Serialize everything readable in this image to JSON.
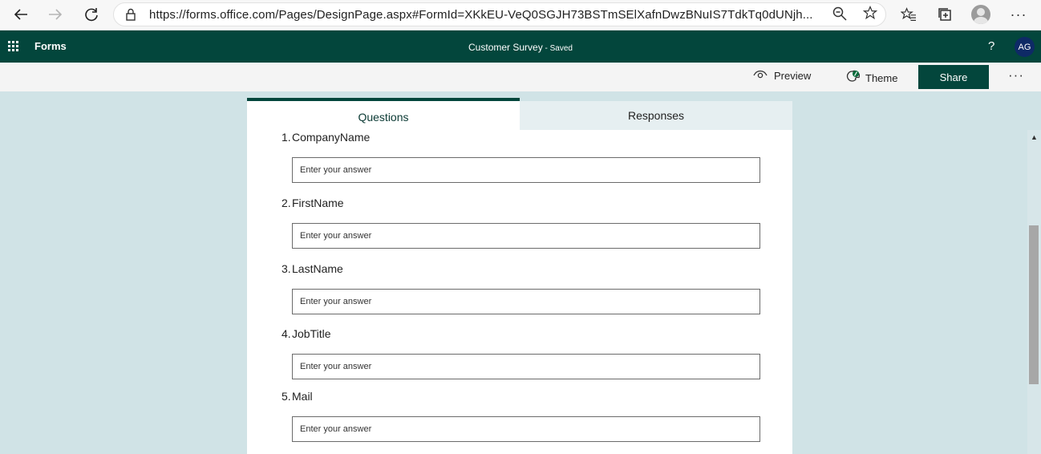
{
  "browser": {
    "url": "https://forms.office.com/Pages/DesignPage.aspx#FormId=XKkEU-VeQ0SGJH73BSTmSElXafnDwzBNuIS7TdkTq0dUNjh...",
    "icons": [
      "back-arrow-icon",
      "forward-arrow-icon",
      "refresh-icon",
      "lock-icon",
      "zoom-icon",
      "favorite-star-icon",
      "favorites-icon",
      "collections-icon",
      "profile-icon",
      "more-icon"
    ]
  },
  "header": {
    "app_name": "Forms",
    "doc_title": "Customer Survey",
    "separator": " - ",
    "status": "Saved",
    "help": "?",
    "avatar_initials": "AG",
    "bg_color": "#03463c"
  },
  "commands": {
    "preview": "Preview",
    "theme": "Theme",
    "share": "Share",
    "more": "···"
  },
  "tabs": {
    "questions": "Questions",
    "responses": "Responses"
  },
  "questions": [
    {
      "number": "1.",
      "title": "CompanyName",
      "placeholder": "Enter your answer"
    },
    {
      "number": "2.",
      "title": "FirstName",
      "placeholder": "Enter your answer"
    },
    {
      "number": "3.",
      "title": "LastName",
      "placeholder": "Enter your answer"
    },
    {
      "number": "4.",
      "title": "JobTitle",
      "placeholder": "Enter your answer"
    },
    {
      "number": "5.",
      "title": "Mail",
      "placeholder": "Enter your answer"
    }
  ]
}
